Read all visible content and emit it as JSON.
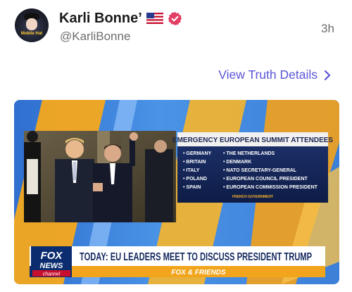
{
  "post": {
    "author": {
      "display_name": "Karli Bonne’",
      "handle": "@KarliBonne",
      "avatar_text": "Mobile Hat",
      "flag_icon": "us-flag-icon",
      "verified_icon": "verified-badge-icon"
    },
    "time": "3h",
    "truth_link": "View Truth Details",
    "accent_color": "#5b55d6"
  },
  "media": {
    "panel_title": "EMERGENCY EUROPEAN SUMMIT ATTENDEES",
    "attendees_left": [
      "GERMANY",
      "BRITAIN",
      "ITALY",
      "POLAND",
      "SPAIN"
    ],
    "attendees_right": [
      "THE NETHERLANDS",
      "DENMARK",
      "NATO SECRETARY-GENERAL",
      "EUROPEAN COUNCIL PRESIDENT",
      "EUROPEAN COMMISSION PRESIDENT"
    ],
    "panel_source": "FRENCH GOVERNMENT",
    "logo_top": "FOX",
    "logo_mid": "NEWS",
    "logo_bottom": "channel",
    "headline": "TODAY: EU LEADERS MEET TO DISCUSS PRESIDENT TRUMP",
    "show_name": "FOX & FRIENDS"
  }
}
